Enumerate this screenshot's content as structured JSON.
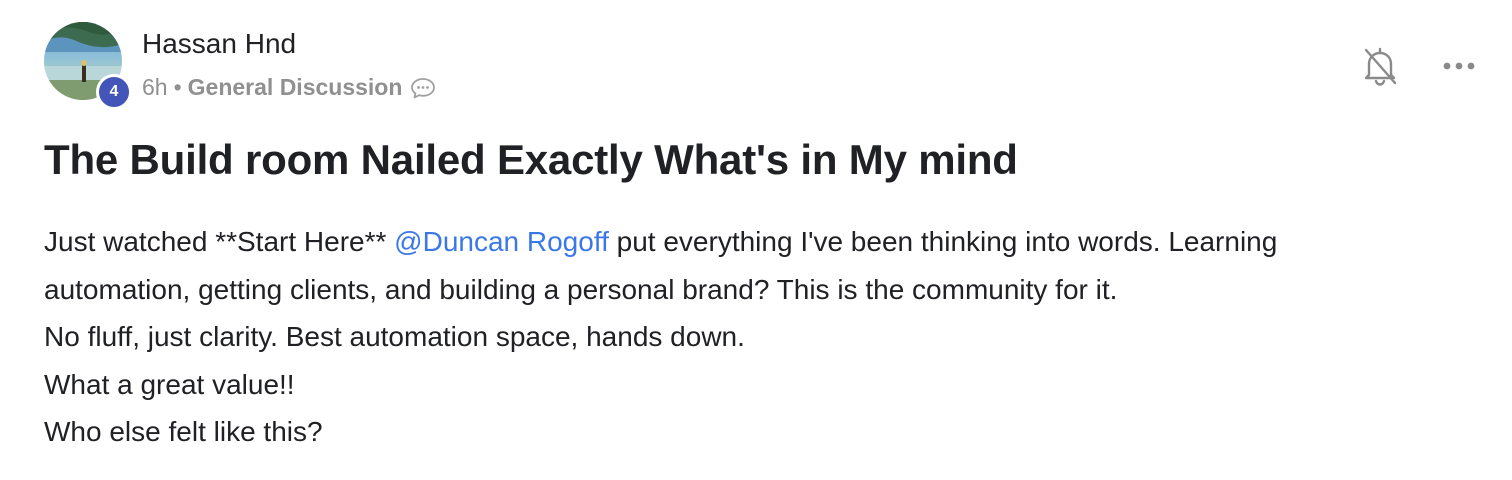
{
  "author": {
    "name": "Hassan Hnd",
    "level": "4",
    "time": "6h",
    "separator": "•",
    "category": "General Discussion"
  },
  "icons": {
    "chat": "chat-bubble-icon",
    "bell": "bell-off-icon",
    "more": "more-horizontal-icon"
  },
  "post": {
    "title": "The Build room Nailed Exactly What's in My mind",
    "line1_before": "Just watched **Start Here** ",
    "mention": "@Duncan Rogoff",
    "line1_after": " put everything I've been thinking into words. Learning",
    "line2": "automation, getting clients, and building a personal brand? This is the community for it.",
    "line3": "No fluff, just clarity. Best automation space, hands down.",
    "line4": "What a great value!!",
    "line5": "Who else felt like this?"
  },
  "colors": {
    "mention": "#3b78e7",
    "level_badge": "#4355b9",
    "meta_gray": "#909090",
    "text": "#202124"
  }
}
